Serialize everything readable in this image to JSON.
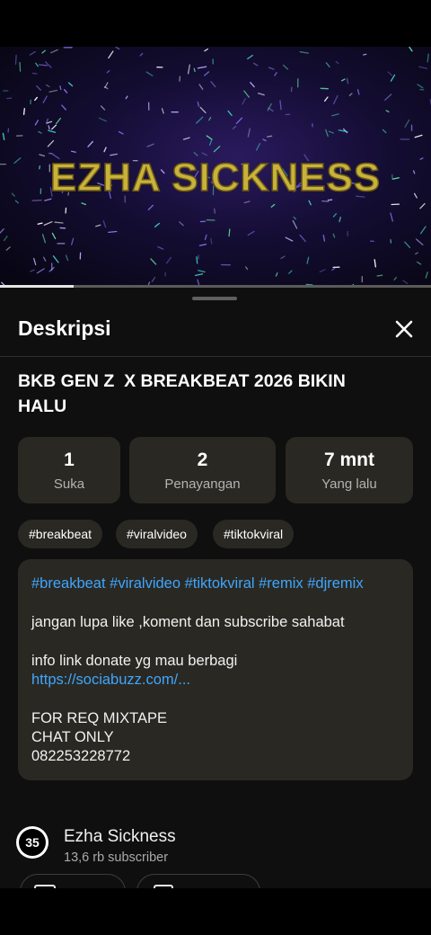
{
  "video": {
    "channel_logo_text": "EZHA SICKNESS",
    "progress_fraction": 0.17
  },
  "sheet": {
    "title": "Deskripsi",
    "close_icon": "close-icon"
  },
  "video_title": "BKB GEN Z  X BREAKBEAT 2026 BIKIN HALU",
  "stats": [
    {
      "value": "1",
      "label": "Suka"
    },
    {
      "value": "2",
      "label": "Penayangan"
    },
    {
      "value": "7 mnt",
      "label": "Yang lalu"
    }
  ],
  "tags": [
    "#breakbeat",
    "#viralvideo",
    "#tiktokviral"
  ],
  "description": {
    "hashtags": "#breakbeat #viralvideo #tiktokviral #remix #djremix",
    "line1": "jangan lupa like ,koment dan subscribe sahabat",
    "line2": "info link donate yg mau berbagi",
    "link": "https://sociabuzz.com/...",
    "line3": "FOR REQ MIXTAPE",
    "line4": "CHAT ONLY",
    "line5": "082253228772"
  },
  "channel": {
    "name": "Ezha Sickness",
    "subscribers": "13,6 rb subscriber",
    "avatar_text": "35"
  },
  "colors": {
    "sheet_bg": "#0f0f0f",
    "card_bg": "#2a2822",
    "link": "#3ea6ff",
    "logo_gold": "#c9b23c"
  }
}
